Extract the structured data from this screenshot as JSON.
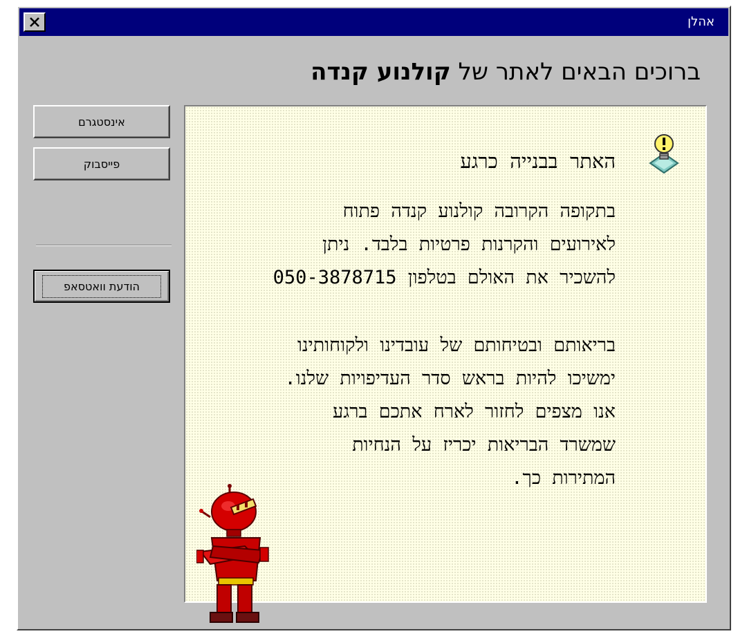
{
  "window": {
    "title": "אהלן",
    "close_icon": "close-icon"
  },
  "header": {
    "prefix": "ברוכים הבאים לאתר של ",
    "brand": "קולנוע קנדה"
  },
  "sidebar": {
    "buttons": [
      {
        "label": "אינסטגרם"
      },
      {
        "label": "פייסבוק"
      },
      {
        "label": "הודעת וואטסאפ"
      }
    ]
  },
  "panel": {
    "icon": "lightbulb-icon",
    "heading": "האתר בבנייה כרגע",
    "paragraph1": [
      "בתקופה הקרובה קולנוע קנדה פתוח",
      "לאירועים והקרנות פרטיות בלבד. ניתן",
      "להשכיר את האולם בטלפון 050-3878715"
    ],
    "paragraph2": [
      "בריאותם ובטיחותם של עובדינו ולקוחותינו",
      "ימשיכו להיות בראש סדר העדיפויות שלנו.",
      "אנו מצפים לחזור לארח אתכם ברגע",
      "שמשרד הבריאות יכריז על הנחיות",
      "המתירות כך."
    ],
    "character": "robot-assistant"
  }
}
